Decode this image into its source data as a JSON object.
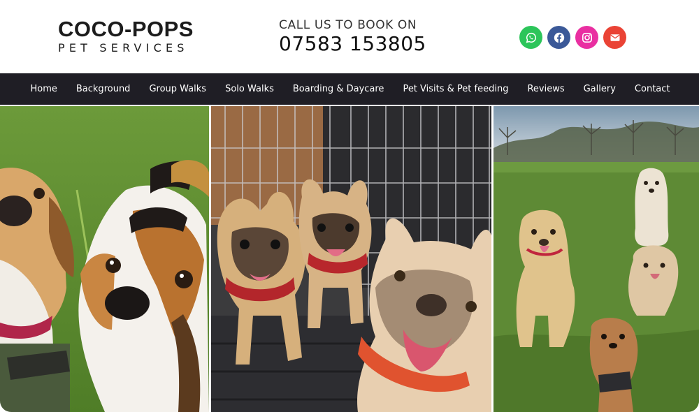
{
  "brand": {
    "name": "COCO-POPS",
    "tagline": "PET SERVICES"
  },
  "contact": {
    "cta": "CALL US TO BOOK ON",
    "phone": "07583 153805"
  },
  "socials": [
    {
      "name": "whatsapp",
      "icon": "whatsapp-icon",
      "color": "#2cc55a"
    },
    {
      "name": "facebook",
      "icon": "facebook-icon",
      "color": "#3b5998"
    },
    {
      "name": "instagram",
      "icon": "instagram-icon",
      "color": "#e92fa1"
    },
    {
      "name": "email",
      "icon": "envelope-icon",
      "color": "#ea4335"
    }
  ],
  "nav": {
    "items": [
      {
        "label": "Home"
      },
      {
        "label": "Background"
      },
      {
        "label": "Group Walks"
      },
      {
        "label": "Solo Walks"
      },
      {
        "label": "Boarding & Daycare"
      },
      {
        "label": "Pet Visits & Pet feeding"
      },
      {
        "label": "Reviews"
      },
      {
        "label": "Gallery"
      },
      {
        "label": "Contact"
      }
    ],
    "background": "#1f1e25"
  },
  "gallery": {
    "photos": [
      {
        "subject": "two beagles on grass"
      },
      {
        "subject": "three french bulldogs by a crate"
      },
      {
        "subject": "group of dogs in a field"
      }
    ]
  }
}
